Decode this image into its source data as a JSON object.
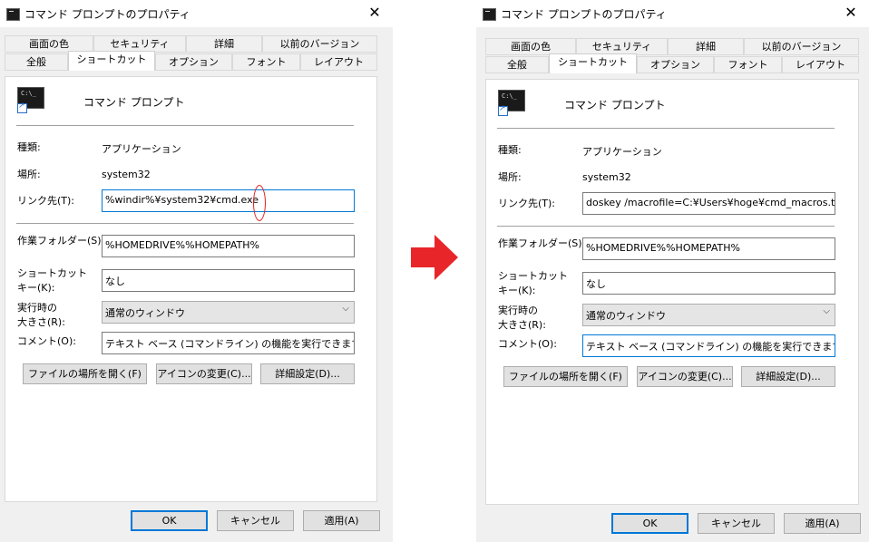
{
  "left": {
    "title": "コマンド プロンプトのプロパティ",
    "tabs_row1": [
      "画面の色",
      "セキュリティ",
      "詳細",
      "以前のバージョン"
    ],
    "tabs_row2": [
      "全般",
      "ショートカット",
      "オプション",
      "フォント",
      "レイアウト"
    ],
    "app_name": "コマンド プロンプト",
    "type_label": "種類:",
    "type_value": "アプリケーション",
    "location_label": "場所:",
    "location_value": "system32",
    "target_label": "リンク先(T):",
    "target_value": "%windir%¥system32¥cmd.exe",
    "workdir_label": "作業フォルダー(S):",
    "workdir_value": "%HOMEDRIVE%%HOMEPATH%",
    "hotkey_label_1": "ショートカット",
    "hotkey_label_2": "キー(K):",
    "hotkey_value": "なし",
    "run_label_1": "実行時の",
    "run_label_2": "大きさ(R):",
    "run_value": "通常のウィンドウ",
    "comment_label": "コメント(O):",
    "comment_value": "テキスト ベース (コマンドライン) の機能を実行できます。",
    "btn_open_location": "ファイルの場所を開く(F)",
    "btn_change_icon": "アイコンの変更(C)...",
    "btn_advanced": "詳細設定(D)...",
    "btn_ok": "OK",
    "btn_cancel": "キャンセル",
    "btn_apply": "適用(A)"
  },
  "right": {
    "title": "コマンド プロンプトのプロパティ",
    "tabs_row1": [
      "画面の色",
      "セキュリティ",
      "詳細",
      "以前のバージョン"
    ],
    "tabs_row2": [
      "全般",
      "ショートカット",
      "オプション",
      "フォント",
      "レイアウト"
    ],
    "app_name": "コマンド プロンプト",
    "type_label": "種類:",
    "type_value": "アプリケーション",
    "location_label": "場所:",
    "location_value": "system32",
    "target_label": "リンク先(T):",
    "target_value": "doskey /macrofile=C:¥Users¥hoge¥cmd_macros.txt",
    "workdir_label": "作業フォルダー(S):",
    "workdir_value": "%HOMEDRIVE%%HOMEPATH%",
    "hotkey_label_1": "ショートカット",
    "hotkey_label_2": "キー(K):",
    "hotkey_value": "なし",
    "run_label_1": "実行時の",
    "run_label_2": "大きさ(R):",
    "run_value": "通常のウィンドウ",
    "comment_label": "コメント(O):",
    "comment_value": "テキスト ベース (コマンドライン) の機能を実行できます。",
    "btn_open_location": "ファイルの場所を開く(F)",
    "btn_change_icon": "アイコンの変更(C)...",
    "btn_advanced": "詳細設定(D)...",
    "btn_ok": "OK",
    "btn_cancel": "キャンセル",
    "btn_apply": "適用(A)"
  },
  "colors": {
    "arrow": "#e8262a",
    "annotation": "#e11d1d",
    "focus": "#0078d7"
  },
  "icons": {
    "close": "close-icon",
    "chevron": "chevron-down-icon",
    "app": "console-app-icon",
    "shortcut": "shortcut-overlay-icon"
  }
}
